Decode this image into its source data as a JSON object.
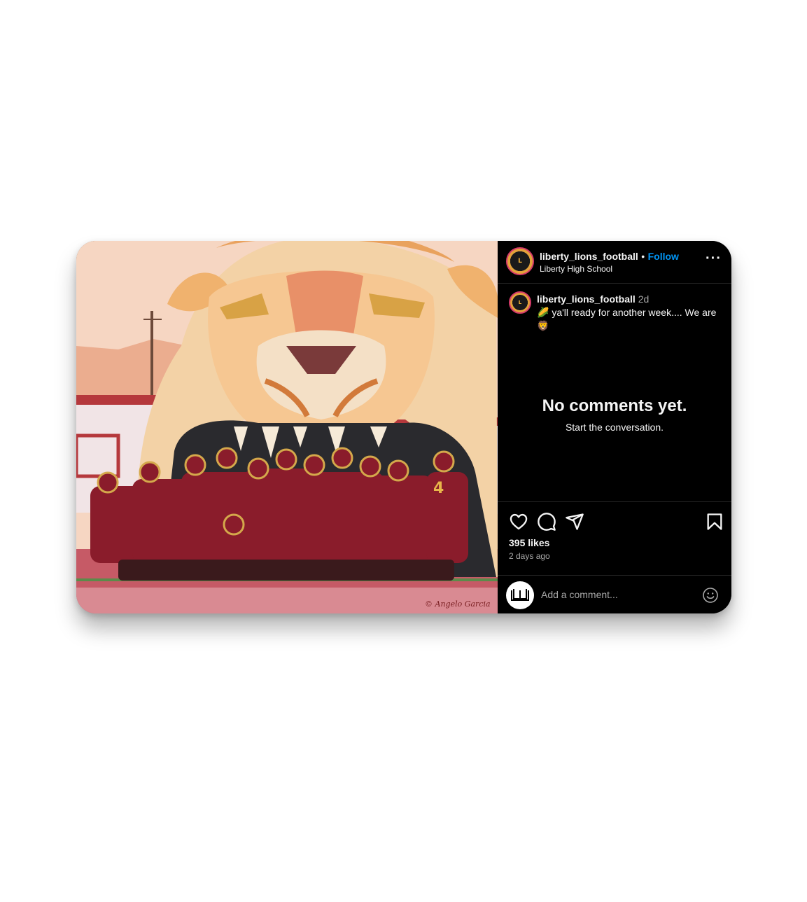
{
  "post": {
    "account": "liberty_lions_football",
    "follow_label": "Follow",
    "separator": "•",
    "location": "Liberty High School",
    "more_icon": "more-icon",
    "caption": {
      "username": "liberty_lions_football",
      "time": "2d",
      "text": "🌽 ya'll ready for another week.... We are 🦁"
    },
    "empty_title": "No comments yet.",
    "empty_subtitle": "Start the conversation.",
    "likes": "395 likes",
    "ago": "2 days ago",
    "comment_placeholder": "Add a comment...",
    "photo_credit": "© Angelo Garcia"
  },
  "colors": {
    "accent": "#0095f6",
    "panel_bg": "#000000",
    "jersey": "#8a1c2b",
    "gold": "#d4a84b"
  }
}
